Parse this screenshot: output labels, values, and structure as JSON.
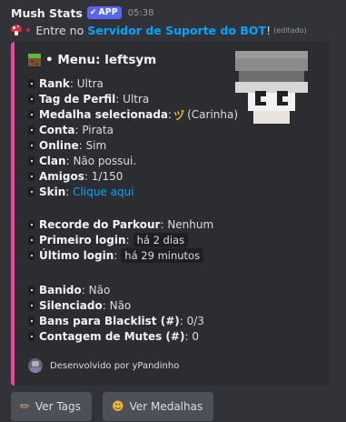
{
  "header": {
    "bot_name": "Mush Stats",
    "app_badge": "APP",
    "check_icon": "✔",
    "timestamp": "05:38"
  },
  "message": {
    "prefix": "Entre no",
    "link": "Servidor de Suporte do BOT",
    "suffix": "!",
    "edited": "(editado)"
  },
  "embed": {
    "accent_color": "#eb459e",
    "title": "• Menu: leftsym",
    "rows": [
      {
        "key": "Rank",
        "value": "Ultra"
      },
      {
        "key": "Tag de Perfil",
        "value": "Ultra"
      },
      {
        "key": "Medalha selecionada",
        "value": "(Carinha)",
        "icon": "ヅ"
      },
      {
        "key": "Conta",
        "value": "Pirata"
      },
      {
        "key": "Online",
        "value": "Sim"
      },
      {
        "key": "Clan",
        "value": "Não possui."
      },
      {
        "key": "Amigos",
        "value": "1/150"
      },
      {
        "key": "Skin",
        "value": "Clique aqui"
      },
      {
        "key": "Recorde do Parkour",
        "value": "Nenhum"
      },
      {
        "key": "Primeiro login",
        "value": "há 2 dias"
      },
      {
        "key": "Último login",
        "value": "há 29 minutos"
      },
      {
        "key": "Banido",
        "value": "Não"
      },
      {
        "key": "Silenciado",
        "value": "Não"
      },
      {
        "key": "Bans para Blacklist (#)",
        "value": "0/3"
      },
      {
        "key": "Contagem de Mutes (#)",
        "value": "0"
      }
    ],
    "separator": ":",
    "footer": "Desenvolvido por yPandinho"
  },
  "buttons": [
    {
      "label": "Ver Tags",
      "icon": "tag-icon"
    },
    {
      "label": "Ver Medalhas",
      "icon": "medal-icon"
    }
  ],
  "colors": {
    "background": "#313338",
    "embed_bg": "#2b2d31",
    "link": "#00a8fc",
    "button": "#4e5058",
    "badge": "#5865f2"
  }
}
